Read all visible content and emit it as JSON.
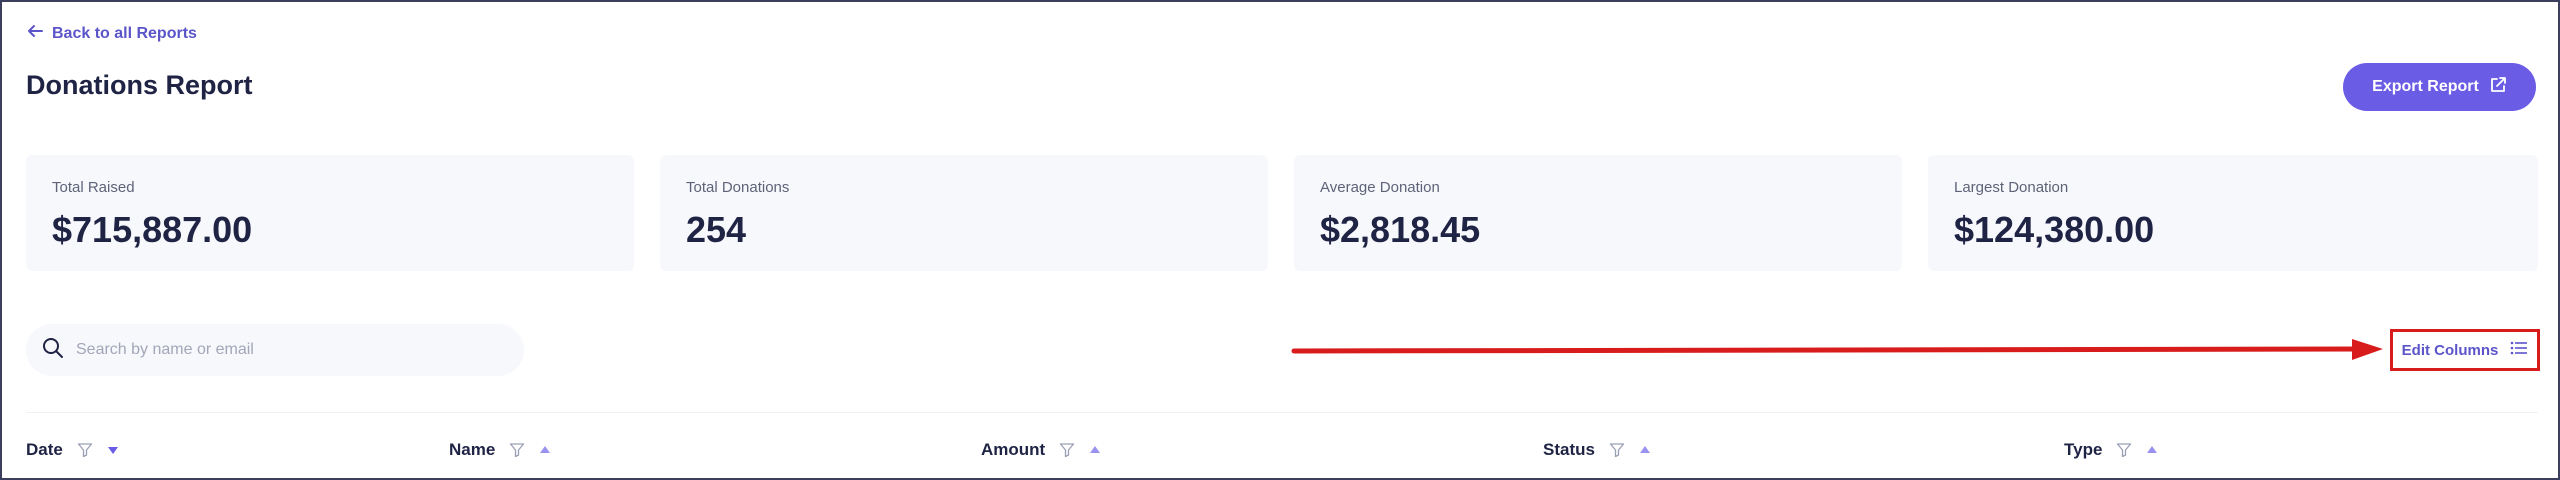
{
  "nav": {
    "back_label": "Back to all Reports"
  },
  "header": {
    "title": "Donations Report",
    "export_label": "Export Report"
  },
  "stats": [
    {
      "label": "Total Raised",
      "value": "$715,887.00"
    },
    {
      "label": "Total Donations",
      "value": "254"
    },
    {
      "label": "Average Donation",
      "value": "$2,818.45"
    },
    {
      "label": "Largest Donation",
      "value": "$124,380.00"
    }
  ],
  "search": {
    "placeholder": "Search by name or email",
    "value": ""
  },
  "toolbar": {
    "edit_columns_label": "Edit Columns"
  },
  "table": {
    "columns": [
      {
        "label": "Date",
        "sort": "descending"
      },
      {
        "label": "Name",
        "sort": "ascending"
      },
      {
        "label": "Amount",
        "sort": "ascending"
      },
      {
        "label": "Status",
        "sort": "ascending"
      },
      {
        "label": "Type",
        "sort": "ascending"
      }
    ]
  },
  "colors": {
    "accent": "#6a5ce5",
    "link": "#5b55c9",
    "text": "#1f2344",
    "card_bg": "#f7f8fc",
    "annotation": "#d81c1c"
  }
}
